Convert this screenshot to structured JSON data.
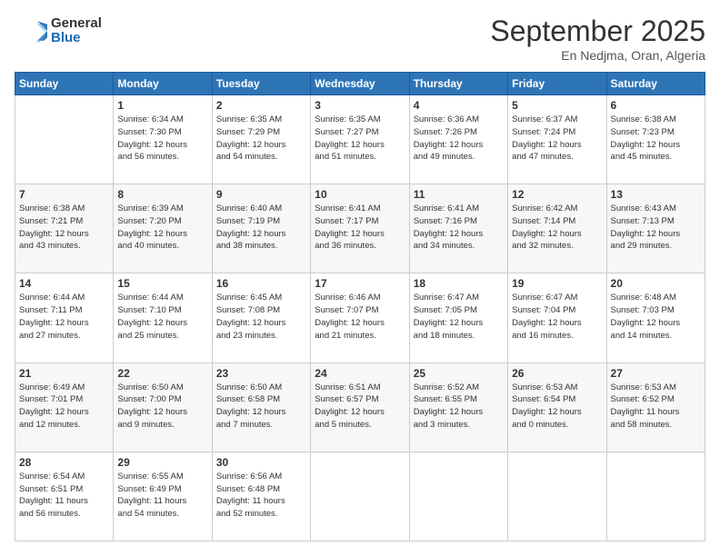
{
  "logo": {
    "general": "General",
    "blue": "Blue"
  },
  "header": {
    "month": "September 2025",
    "location": "En Nedjma, Oran, Algeria"
  },
  "days": [
    "Sunday",
    "Monday",
    "Tuesday",
    "Wednesday",
    "Thursday",
    "Friday",
    "Saturday"
  ],
  "weeks": [
    [
      {
        "day": "",
        "info": ""
      },
      {
        "day": "1",
        "info": "Sunrise: 6:34 AM\nSunset: 7:30 PM\nDaylight: 12 hours\nand 56 minutes."
      },
      {
        "day": "2",
        "info": "Sunrise: 6:35 AM\nSunset: 7:29 PM\nDaylight: 12 hours\nand 54 minutes."
      },
      {
        "day": "3",
        "info": "Sunrise: 6:35 AM\nSunset: 7:27 PM\nDaylight: 12 hours\nand 51 minutes."
      },
      {
        "day": "4",
        "info": "Sunrise: 6:36 AM\nSunset: 7:26 PM\nDaylight: 12 hours\nand 49 minutes."
      },
      {
        "day": "5",
        "info": "Sunrise: 6:37 AM\nSunset: 7:24 PM\nDaylight: 12 hours\nand 47 minutes."
      },
      {
        "day": "6",
        "info": "Sunrise: 6:38 AM\nSunset: 7:23 PM\nDaylight: 12 hours\nand 45 minutes."
      }
    ],
    [
      {
        "day": "7",
        "info": "Sunrise: 6:38 AM\nSunset: 7:21 PM\nDaylight: 12 hours\nand 43 minutes."
      },
      {
        "day": "8",
        "info": "Sunrise: 6:39 AM\nSunset: 7:20 PM\nDaylight: 12 hours\nand 40 minutes."
      },
      {
        "day": "9",
        "info": "Sunrise: 6:40 AM\nSunset: 7:19 PM\nDaylight: 12 hours\nand 38 minutes."
      },
      {
        "day": "10",
        "info": "Sunrise: 6:41 AM\nSunset: 7:17 PM\nDaylight: 12 hours\nand 36 minutes."
      },
      {
        "day": "11",
        "info": "Sunrise: 6:41 AM\nSunset: 7:16 PM\nDaylight: 12 hours\nand 34 minutes."
      },
      {
        "day": "12",
        "info": "Sunrise: 6:42 AM\nSunset: 7:14 PM\nDaylight: 12 hours\nand 32 minutes."
      },
      {
        "day": "13",
        "info": "Sunrise: 6:43 AM\nSunset: 7:13 PM\nDaylight: 12 hours\nand 29 minutes."
      }
    ],
    [
      {
        "day": "14",
        "info": "Sunrise: 6:44 AM\nSunset: 7:11 PM\nDaylight: 12 hours\nand 27 minutes."
      },
      {
        "day": "15",
        "info": "Sunrise: 6:44 AM\nSunset: 7:10 PM\nDaylight: 12 hours\nand 25 minutes."
      },
      {
        "day": "16",
        "info": "Sunrise: 6:45 AM\nSunset: 7:08 PM\nDaylight: 12 hours\nand 23 minutes."
      },
      {
        "day": "17",
        "info": "Sunrise: 6:46 AM\nSunset: 7:07 PM\nDaylight: 12 hours\nand 21 minutes."
      },
      {
        "day": "18",
        "info": "Sunrise: 6:47 AM\nSunset: 7:05 PM\nDaylight: 12 hours\nand 18 minutes."
      },
      {
        "day": "19",
        "info": "Sunrise: 6:47 AM\nSunset: 7:04 PM\nDaylight: 12 hours\nand 16 minutes."
      },
      {
        "day": "20",
        "info": "Sunrise: 6:48 AM\nSunset: 7:03 PM\nDaylight: 12 hours\nand 14 minutes."
      }
    ],
    [
      {
        "day": "21",
        "info": "Sunrise: 6:49 AM\nSunset: 7:01 PM\nDaylight: 12 hours\nand 12 minutes."
      },
      {
        "day": "22",
        "info": "Sunrise: 6:50 AM\nSunset: 7:00 PM\nDaylight: 12 hours\nand 9 minutes."
      },
      {
        "day": "23",
        "info": "Sunrise: 6:50 AM\nSunset: 6:58 PM\nDaylight: 12 hours\nand 7 minutes."
      },
      {
        "day": "24",
        "info": "Sunrise: 6:51 AM\nSunset: 6:57 PM\nDaylight: 12 hours\nand 5 minutes."
      },
      {
        "day": "25",
        "info": "Sunrise: 6:52 AM\nSunset: 6:55 PM\nDaylight: 12 hours\nand 3 minutes."
      },
      {
        "day": "26",
        "info": "Sunrise: 6:53 AM\nSunset: 6:54 PM\nDaylight: 12 hours\nand 0 minutes."
      },
      {
        "day": "27",
        "info": "Sunrise: 6:53 AM\nSunset: 6:52 PM\nDaylight: 11 hours\nand 58 minutes."
      }
    ],
    [
      {
        "day": "28",
        "info": "Sunrise: 6:54 AM\nSunset: 6:51 PM\nDaylight: 11 hours\nand 56 minutes."
      },
      {
        "day": "29",
        "info": "Sunrise: 6:55 AM\nSunset: 6:49 PM\nDaylight: 11 hours\nand 54 minutes."
      },
      {
        "day": "30",
        "info": "Sunrise: 6:56 AM\nSunset: 6:48 PM\nDaylight: 11 hours\nand 52 minutes."
      },
      {
        "day": "",
        "info": ""
      },
      {
        "day": "",
        "info": ""
      },
      {
        "day": "",
        "info": ""
      },
      {
        "day": "",
        "info": ""
      }
    ]
  ]
}
